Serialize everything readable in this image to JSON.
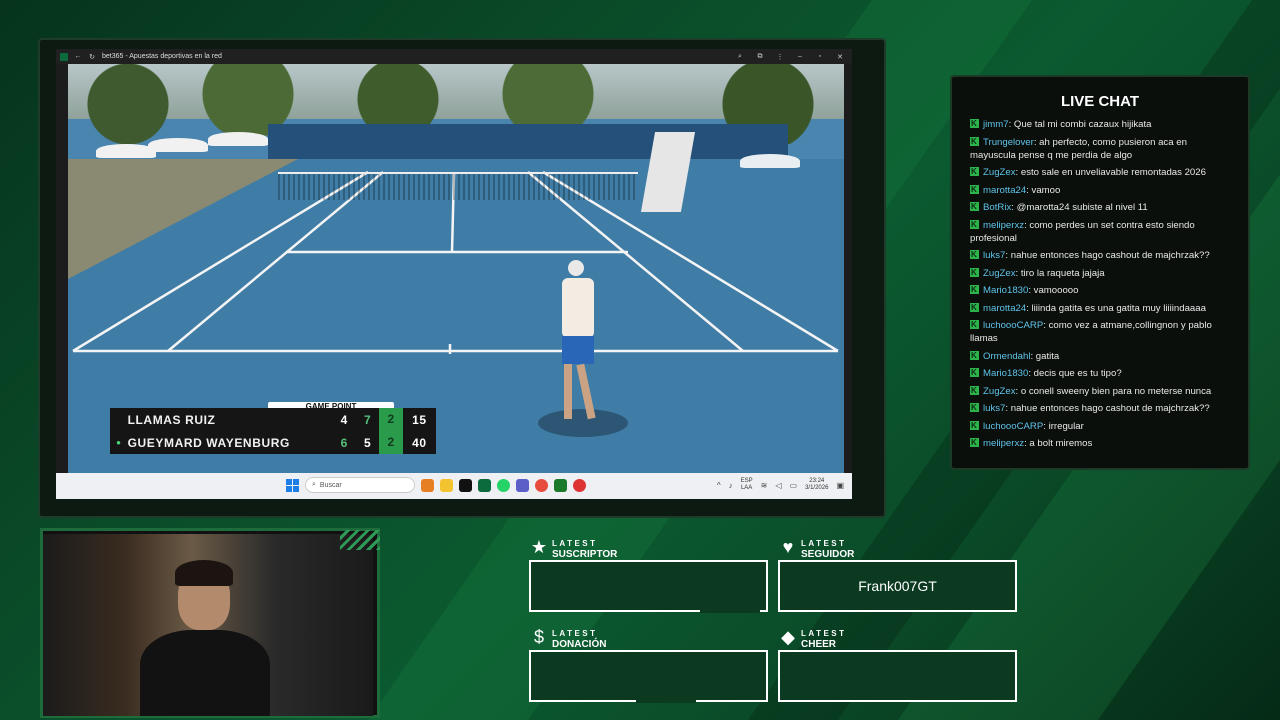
{
  "browser": {
    "tab_title": "bet365 - Apuestas deportivas en la red"
  },
  "scoreboard": {
    "banner": "GAME POINT",
    "players": [
      {
        "name": "LLAMAS RUIZ",
        "serving": false,
        "set1": "4",
        "set2": "7",
        "set3": "2",
        "points": "15"
      },
      {
        "name": "GUEYMARD WAYENBURG",
        "serving": true,
        "set1": "6",
        "set2": "5",
        "set3": "2",
        "points": "40"
      }
    ]
  },
  "taskbar": {
    "search_placeholder": "Buscar",
    "lang_top": "ESP",
    "lang_bottom": "LAA",
    "time": "23:24",
    "date": "3/1/2026"
  },
  "chat": {
    "title": "LIVE CHAT",
    "messages": [
      {
        "user": "jimm7",
        "text": ": Que tal mi combi cazaux hijikata"
      },
      {
        "user": "Trungelover",
        "text": ": ah perfecto, como pusieron aca en mayuscula pense q me perdia de algo"
      },
      {
        "user": "ZugZex",
        "text": ": esto sale en unveliavable remontadas 2026"
      },
      {
        "user": "marotta24",
        "text": ": vamoo"
      },
      {
        "user": "BotRix",
        "text": ": @marotta24 subiste al nivel 11"
      },
      {
        "user": "meliperxz",
        "text": ": como perdes un set contra esto siendo profesional"
      },
      {
        "user": "luks7",
        "text": ": nahue entonces hago cashout de majchrzak??"
      },
      {
        "user": "ZugZex",
        "text": ": tiro la raqueta jajaja"
      },
      {
        "user": "Mario1830",
        "text": ": vamooooo"
      },
      {
        "user": "marotta24",
        "text": ": liiinda gatita es una gatita muy liiiindaaaa"
      },
      {
        "user": "luchoooCARP",
        "text": ": como vez a atmane,collingnon y pablo llamas"
      },
      {
        "user": "Ormendahl",
        "text": ": gatita"
      },
      {
        "user": "Mario1830",
        "text": ": decis que es tu tipo?"
      },
      {
        "user": "ZugZex",
        "text": ": o conell sweeny bien para no meterse nunca"
      },
      {
        "user": "luks7",
        "text": ": nahue entonces hago cashout de majchrzak??"
      },
      {
        "user": "luchoooCARP",
        "text": ": irregular"
      },
      {
        "user": "meliperxz",
        "text": ": a bolt miremos"
      }
    ]
  },
  "latest": {
    "suscriptor": {
      "small": "LATEST",
      "big": "SUSCRIPTOR",
      "value": ""
    },
    "seguidor": {
      "small": "LATEST",
      "big": "SEGUIDOR",
      "value": "Frank007GT"
    },
    "donacion": {
      "small": "LATEST",
      "big": "DONACIÓN",
      "value": ""
    },
    "cheer": {
      "small": "LATEST",
      "big": "CHEER",
      "value": ""
    }
  },
  "colors": {
    "accent": "#2cb34a",
    "chat_username": "#5fc4ea",
    "background": "#0a4a28"
  }
}
